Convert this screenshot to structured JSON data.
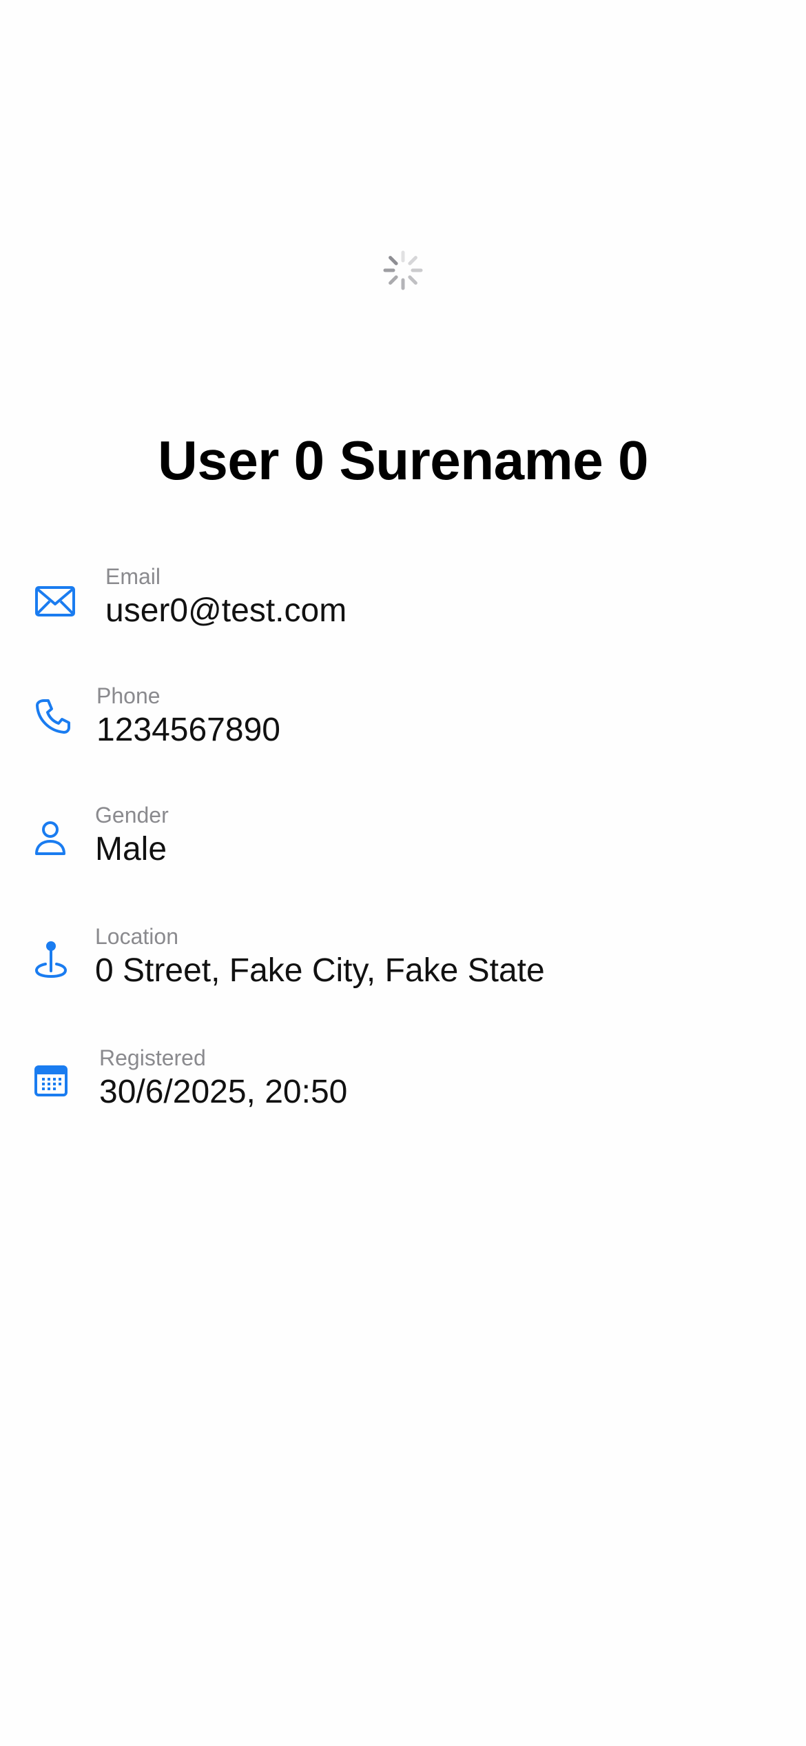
{
  "header": {
    "loading_icon": "activity-spinner-icon"
  },
  "profile": {
    "name": "User 0 Surename 0"
  },
  "accent_color": "#1a7cf0",
  "fields": {
    "email": {
      "icon": "envelope-icon",
      "label": "Email",
      "value": "user0@test.com"
    },
    "phone": {
      "icon": "phone-icon",
      "label": "Phone",
      "value": "1234567890"
    },
    "gender": {
      "icon": "person-icon",
      "label": "Gender",
      "value": "Male"
    },
    "location": {
      "icon": "map-pin-icon",
      "label": "Location",
      "value": "0 Street, Fake City, Fake State"
    },
    "registered": {
      "icon": "calendar-icon",
      "label": "Registered",
      "value": "30/6/2025, 20:50"
    }
  }
}
